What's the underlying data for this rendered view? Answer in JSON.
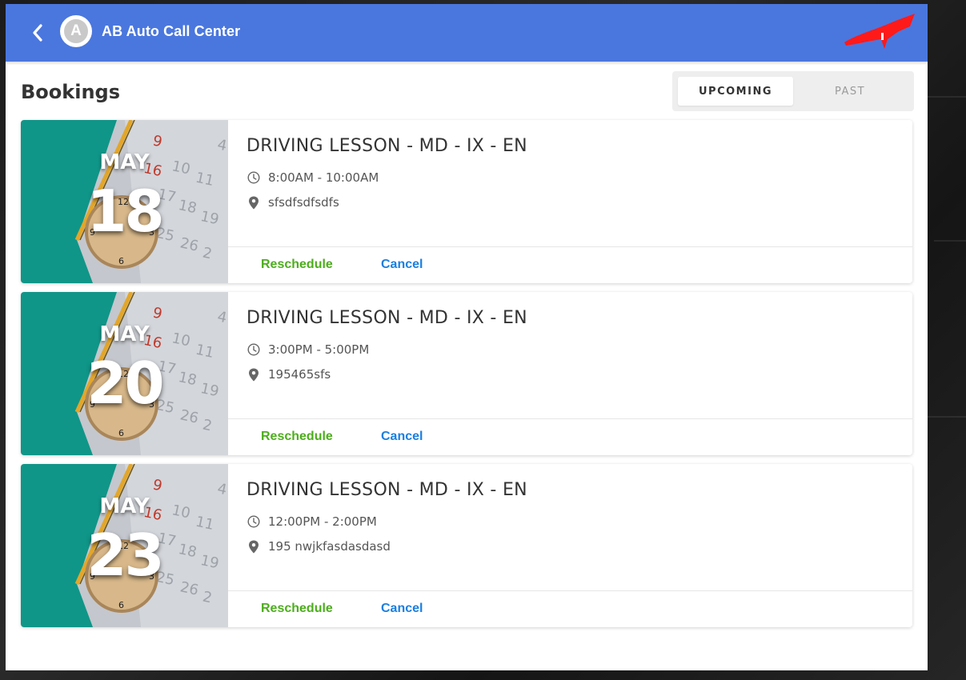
{
  "header": {
    "back_icon": "chevron-left-icon",
    "avatar_letter": "A",
    "app_title": "AB Auto Call Center",
    "brand_color": "#4a77de"
  },
  "page": {
    "title": "Bookings"
  },
  "tabs": [
    {
      "label": "UPCOMING",
      "active": true
    },
    {
      "label": "PAST",
      "active": false
    }
  ],
  "bookings": [
    {
      "month": "MAY",
      "day": "18",
      "title": "DRIVING LESSON - MD - IX - EN",
      "time": "8:00AM - 10:00AM",
      "location": "sfsdfsdfsdfs",
      "reschedule_label": "Reschedule",
      "cancel_label": "Cancel"
    },
    {
      "month": "MAY",
      "day": "20",
      "title": "DRIVING LESSON - MD - IX - EN",
      "time": "3:00PM - 5:00PM",
      "location": "195465sfs",
      "reschedule_label": "Reschedule",
      "cancel_label": "Cancel"
    },
    {
      "month": "MAY",
      "day": "23",
      "title": "DRIVING LESSON - MD - IX - EN",
      "time": "12:00PM - 2:00PM",
      "location": "195 nwjkfasdasdasd",
      "reschedule_label": "Reschedule",
      "cancel_label": "Cancel"
    }
  ],
  "colors": {
    "reschedule": "#4cae1c",
    "cancel": "#1a7fe0"
  },
  "icons": {
    "time": "clock-icon",
    "location": "map-pin-icon"
  }
}
